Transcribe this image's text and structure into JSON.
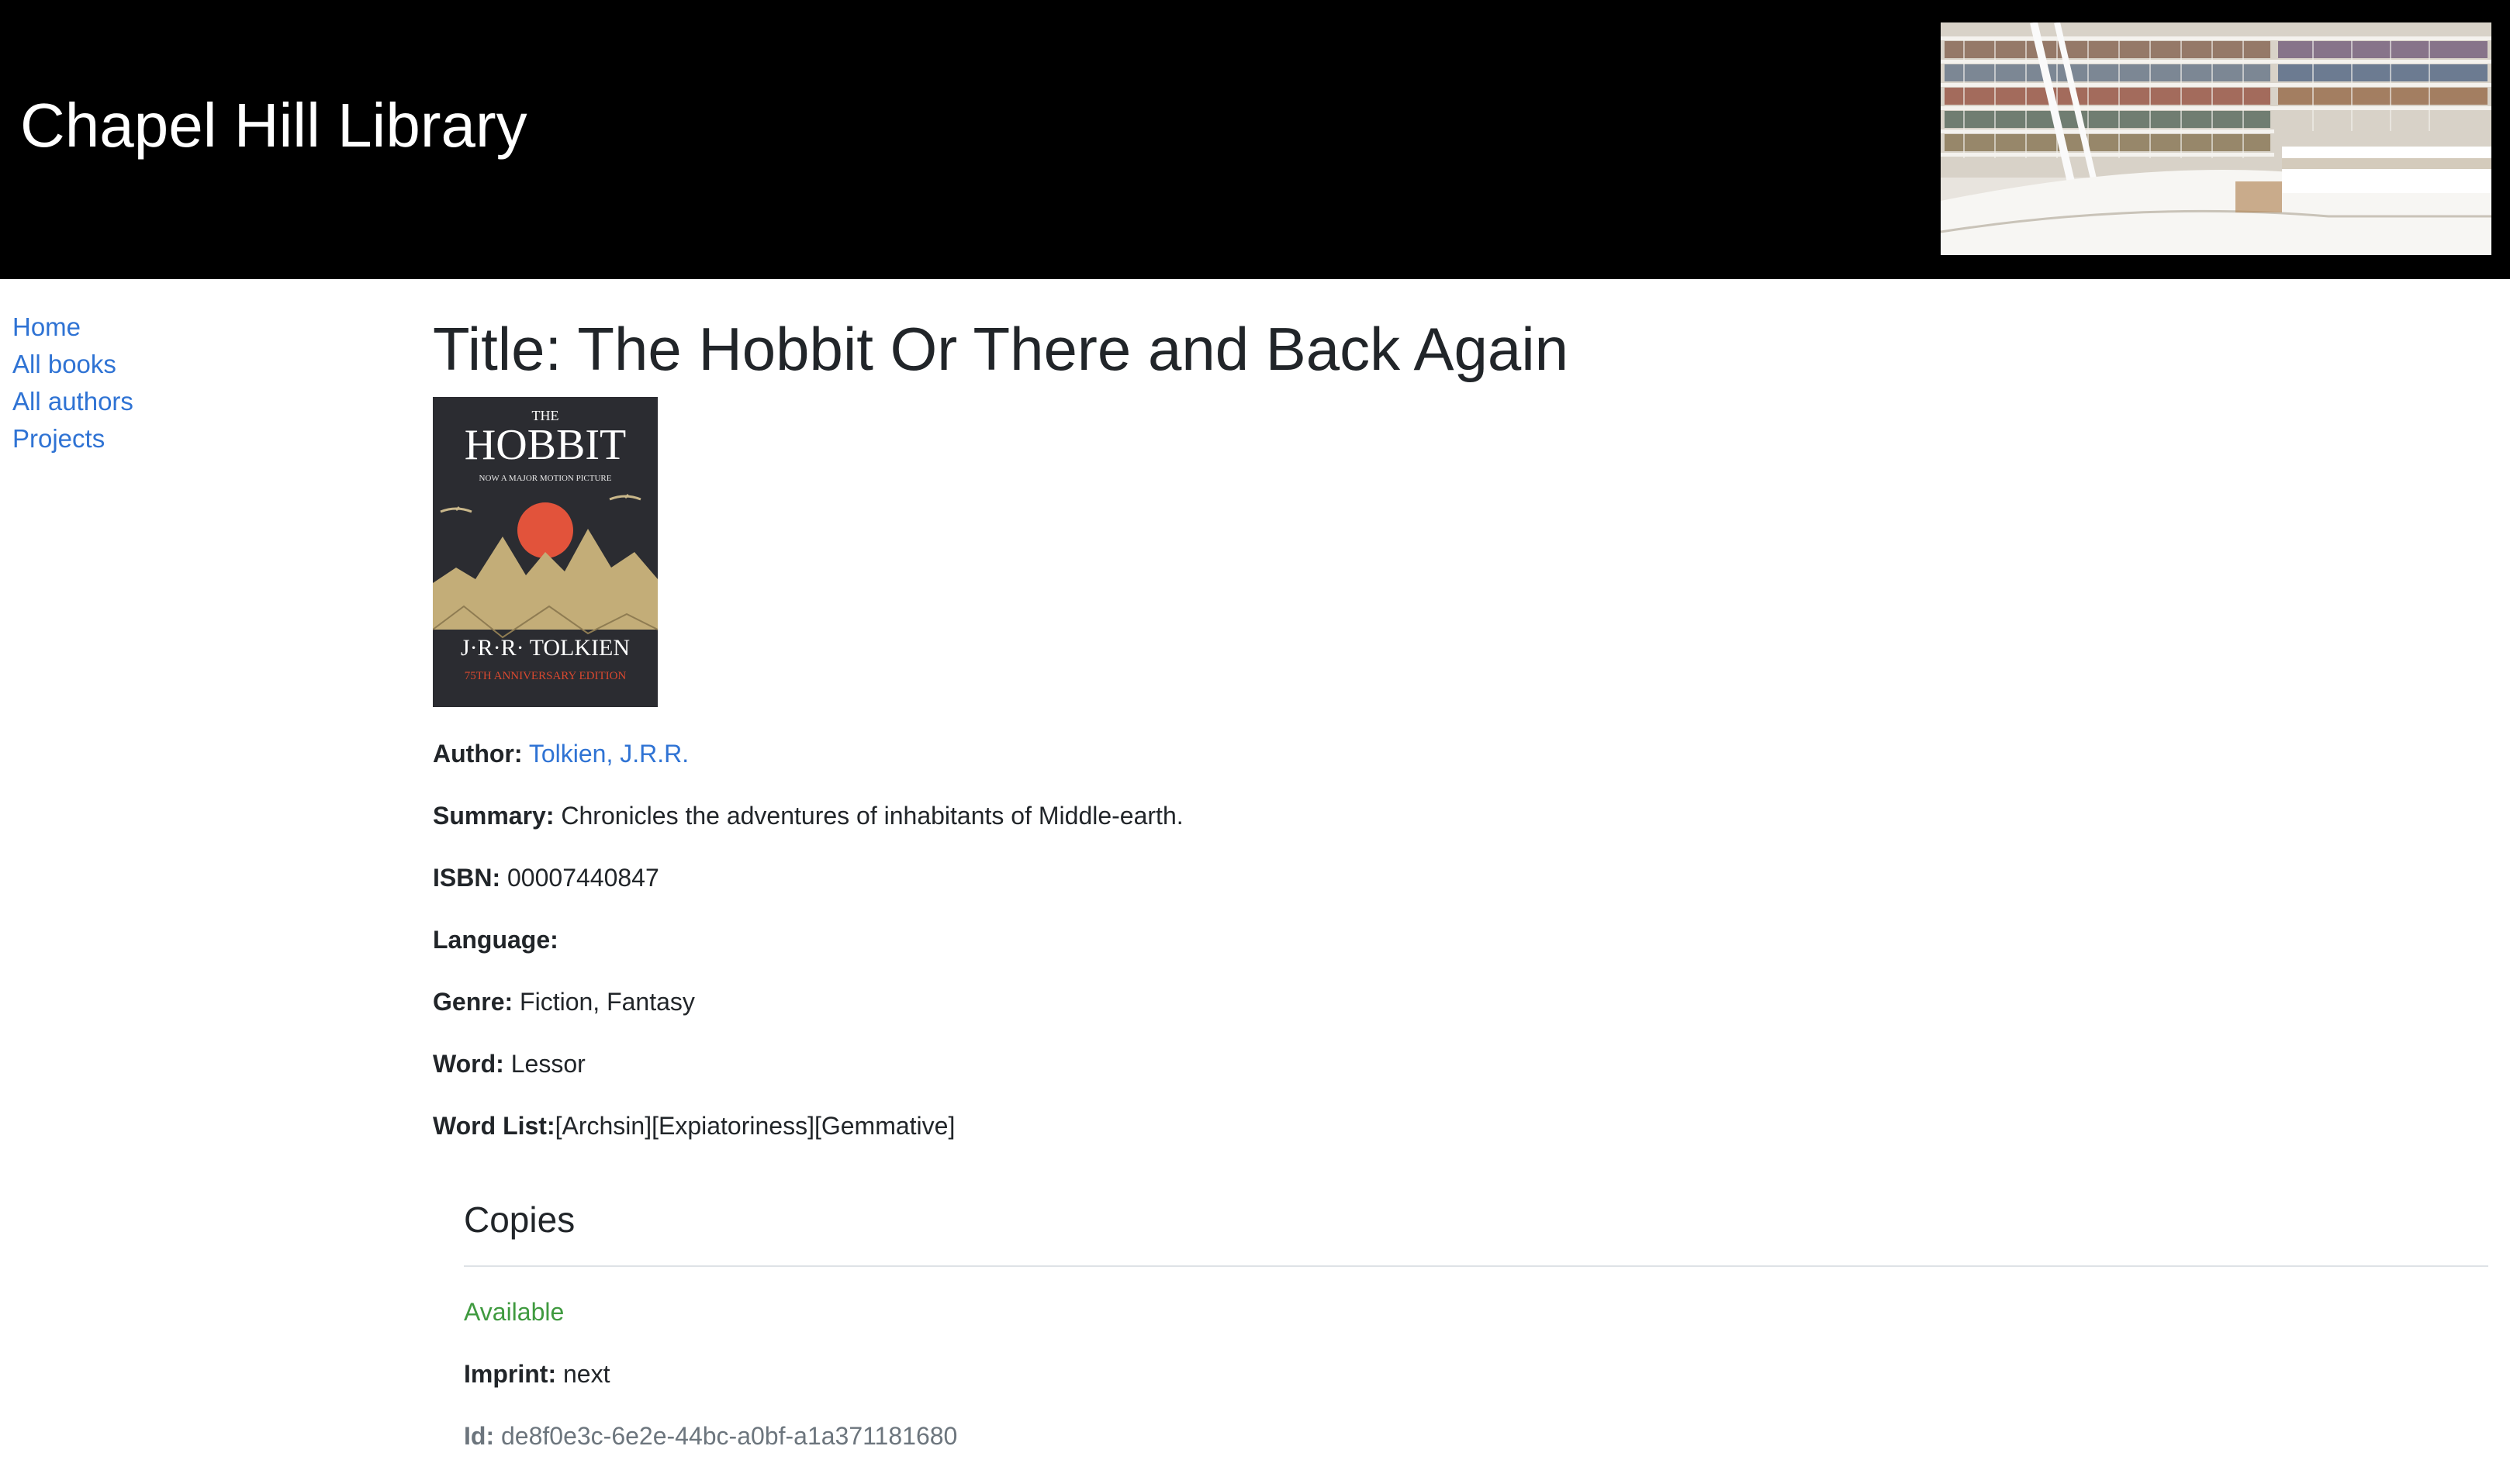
{
  "site": {
    "title": "Chapel Hill Library"
  },
  "nav": [
    {
      "label": "Home"
    },
    {
      "label": "All books"
    },
    {
      "label": "All authors"
    },
    {
      "label": "Projects"
    }
  ],
  "book": {
    "title": "Title: The Hobbit Or There and Back Again",
    "cover": {
      "top_text": "THE",
      "title": "HOBBIT",
      "subtitle": "NOW A MAJOR MOTION PICTURE",
      "author": "J·R·R· TOLKIEN",
      "edition": "75TH ANNIVERSARY EDITION"
    },
    "author_label": "Author:",
    "author": "Tolkien, J.R.R.",
    "summary_label": "Summary:",
    "summary": "Chronicles the adventures of inhabitants of Middle-earth.",
    "isbn_label": "ISBN:",
    "isbn": "00007440847",
    "language_label": "Language:",
    "language": "",
    "genre_label": "Genre:",
    "genre": "Fiction, Fantasy",
    "word_label": "Word:",
    "word": "Lessor",
    "word_list_label": "Word List:",
    "word_list": "[Archsin][Expiatoriness][Gemmative]"
  },
  "copies": {
    "heading": "Copies",
    "status": "Available",
    "imprint_label": "Imprint:",
    "imprint": "next",
    "id_label": "Id:",
    "id": "de8f0e3c-6e2e-44bc-a0bf-a1a371181680"
  },
  "colors": {
    "header_bg": "#000000",
    "link": "#2f73d4",
    "available": "#3f9a3f",
    "muted": "#6c757d"
  }
}
